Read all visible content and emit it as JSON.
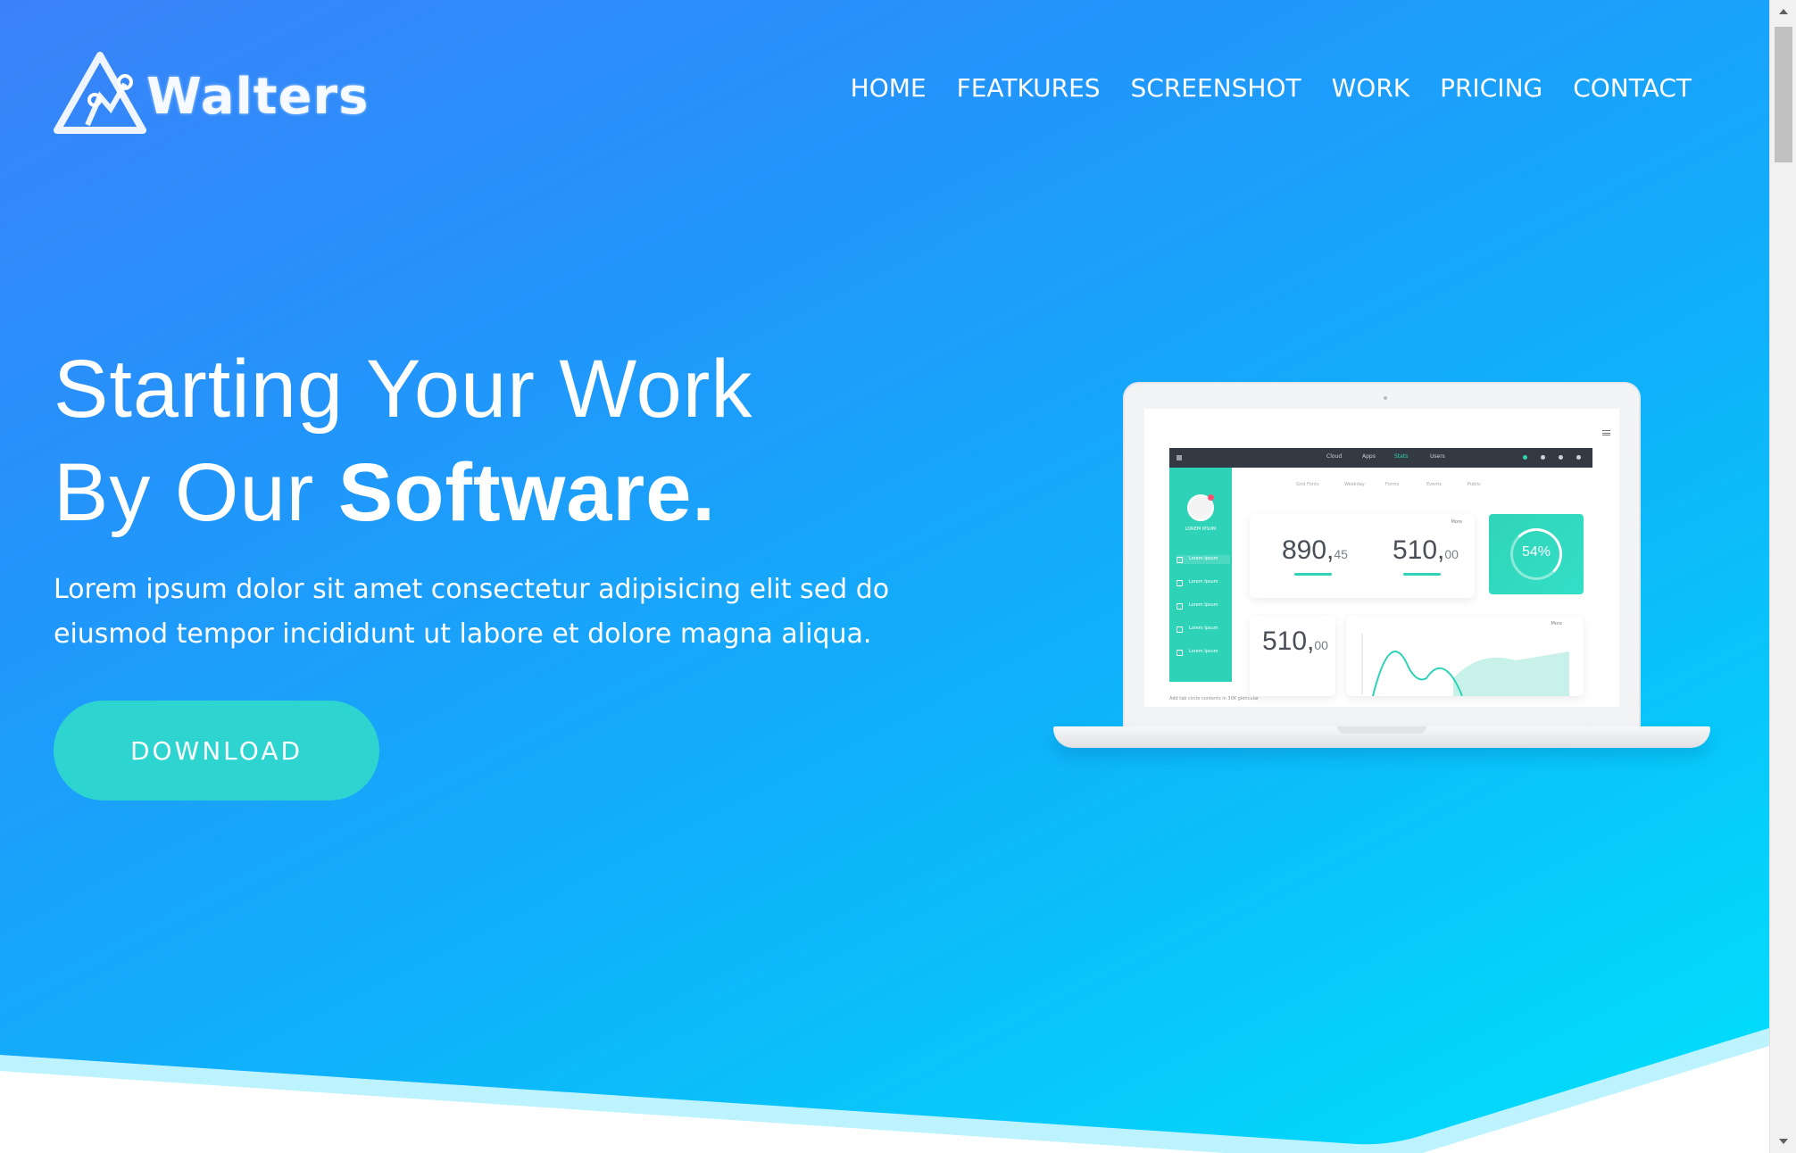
{
  "brand": {
    "name": "Walters",
    "logo_icon": "triangle-graph-logo-icon"
  },
  "nav": {
    "items": [
      "HOME",
      "FEATKURES",
      "SCREENSHOT",
      "WORK",
      "PRICING",
      "CONTACT"
    ]
  },
  "hero": {
    "headline_line1": "Starting Your Work",
    "headline_line2_prefix": "By Our ",
    "headline_line2_strong": "Software.",
    "lead": "Lorem ipsum dolor sit amet consectetur adipisicing elit sed do eiusmod tempor incididunt ut labore et dolore magna aliqua.",
    "cta_label": "DOWNLOAD"
  },
  "dashboard": {
    "tabs": [
      "Cloud",
      "Apps",
      "Stats",
      "Users"
    ],
    "active_tab": "Stats",
    "subnav": [
      "Grid Fonts",
      "Weekday",
      "Forms",
      "Events",
      "Public"
    ],
    "user_name": "LOREM IPSUM",
    "sidebar_items": [
      "Lorem Ipsum",
      "Lorem Ipsum",
      "Lorem Ipsum",
      "Lorem Ipsum",
      "Lorem Ipsum"
    ],
    "stat1_main": "890,",
    "stat1_dec": "45",
    "stat2_main": "510,",
    "stat2_dec": "00",
    "stat3_main": "510,",
    "stat3_dec": "00",
    "card_menu": "More",
    "percent": "54%",
    "footer": "Add tab circle contents in 30K gleticular"
  },
  "colors": {
    "gradient_start": "#3b82f8",
    "gradient_end": "#00e2fb",
    "cta": "#2ed5d0",
    "dashboard_accent": "#2ed3b7"
  }
}
